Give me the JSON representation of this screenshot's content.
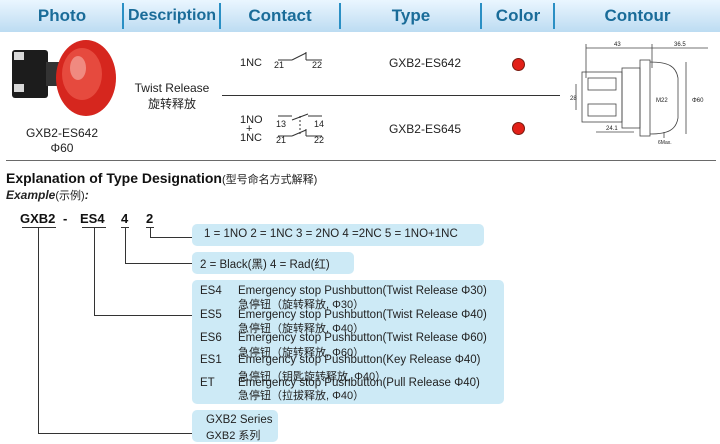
{
  "header": {
    "photo": "Photo",
    "description": "Description",
    "contact": "Contact",
    "type": "Type",
    "color": "Color",
    "contour": "Contour"
  },
  "product": {
    "model": "GXB2-ES642",
    "diameter": "Φ60",
    "desc_en": "Twist Release",
    "desc_cn": "旋转释放"
  },
  "rows": [
    {
      "contact_label": "1NC",
      "contact_label2": "",
      "plus": "",
      "term_a": "21",
      "term_b": "22",
      "term_c": "",
      "term_d": "",
      "type": "GXB2-ES642",
      "color": "#e22018"
    },
    {
      "contact_label": "1NO",
      "contact_label2": "1NC",
      "plus": "+",
      "term_a": "13",
      "term_b": "14",
      "term_c": "21",
      "term_d": "22",
      "type": "GXB2-ES645",
      "color": "#e22018"
    }
  ],
  "contour": {
    "dim_top": "43",
    "dim_top2": "36.5",
    "dim_left": "28",
    "dim_mid": "M22",
    "dim_right": "Φ60",
    "dim_bottom": "24.1",
    "dim_max": "6Max."
  },
  "explanation": {
    "title": "Explanation of Type Designation",
    "title_cn": "(型号命名方式解释)",
    "example_label": "Example",
    "example_cn": "(示例)",
    "example_colon": ":"
  },
  "code": {
    "part1": "GXB2",
    "dash": "-",
    "part2": "ES4",
    "part3": "4",
    "part4": "2"
  },
  "boxes": {
    "contacts": "1 = 1NO   2 = 1NC   3 = 2NO  4 =2NC  5 = 1NO+1NC",
    "colors": "2 = Black(黑)   4 = Rad(红)",
    "series_en": "GXB2 Series",
    "series_cn": "GXB2 系列"
  },
  "designations": [
    {
      "code": "ES4",
      "en": "Emergency stop Pushbutton(Twist Release Φ30)",
      "cn": "急停钮（旋转释放, Φ30）"
    },
    {
      "code": "ES5",
      "en": "Emergency stop Pushbutton(Twist Release Φ40)",
      "cn": "急停钮（旋转释放, Φ40）"
    },
    {
      "code": "ES6",
      "en": "Emergency stop Pushbutton(Twist Release Φ60)",
      "cn": "急停钮（旋转释放, Φ60）"
    },
    {
      "code": "ES1",
      "en": "Emergency stop Pushbutton(Key Release    Φ40)",
      "cn": "急停钮（钥匙旋转释放, Φ40）"
    },
    {
      "code": "ET",
      "en": "Emergency stop Pushbutton(Pull Release   Φ40)",
      "cn": "急停钮（拉拔释放, Φ40）"
    }
  ]
}
